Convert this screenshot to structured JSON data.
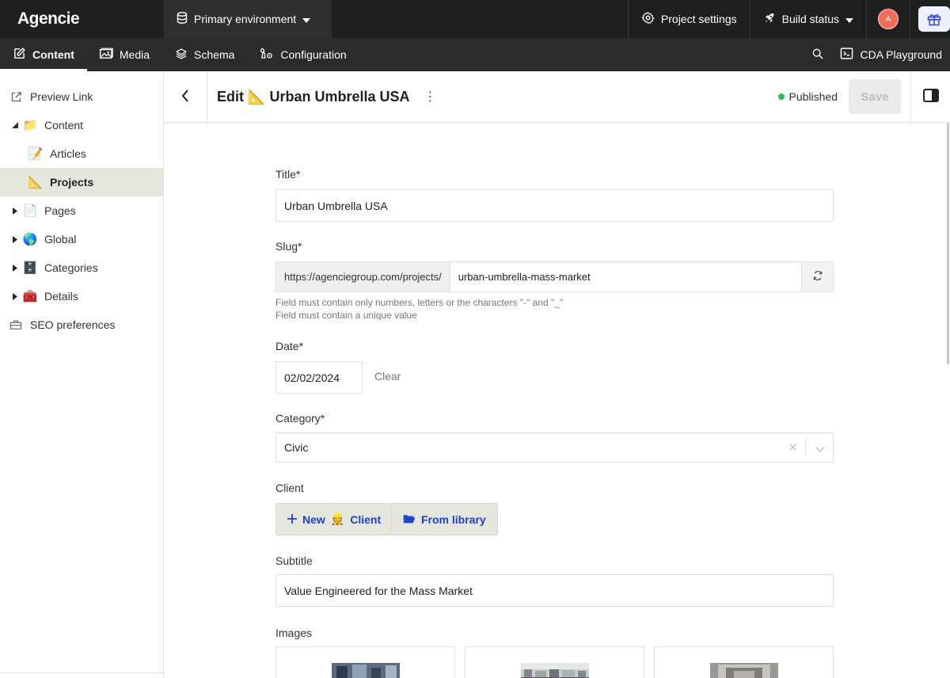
{
  "topbar": {
    "brand": "Agencie",
    "environment": "Primary environment",
    "project_settings": "Project settings",
    "build_status": "Build status",
    "avatar_initial": "A"
  },
  "navbar": {
    "items": [
      {
        "label": "Content",
        "icon": "edit-icon",
        "active": true
      },
      {
        "label": "Media",
        "icon": "image-icon"
      },
      {
        "label": "Schema",
        "icon": "layers-icon"
      },
      {
        "label": "Configuration",
        "icon": "wrench-icon"
      }
    ],
    "cda_playground": "CDA Playground"
  },
  "sidebar": {
    "items": [
      {
        "label": "Preview Link",
        "icon": "external-link-icon"
      },
      {
        "label": "Content",
        "emoji": "📁",
        "expanded": true
      },
      {
        "label": "Articles",
        "emoji": "📝"
      },
      {
        "label": "Projects",
        "emoji": "📐",
        "active": true
      },
      {
        "label": "Pages",
        "emoji": "📄"
      },
      {
        "label": "Global",
        "emoji": "🌎"
      },
      {
        "label": "Categories",
        "emoji": "🗄️"
      },
      {
        "label": "Details",
        "emoji": "🧰"
      },
      {
        "label": "SEO preferences",
        "icon": "toolbox-icon"
      }
    ]
  },
  "header": {
    "title_prefix": "Edit",
    "title_emoji": "📐",
    "title": "Urban Umbrella USA",
    "status": "Published",
    "save_label": "Save"
  },
  "form": {
    "title_label": "Title*",
    "title_value": "Urban Umbrella USA",
    "slug_label": "Slug*",
    "slug_prefix": "https://agenciegroup.com/projects/",
    "slug_value": "urban-umbrella-mass-market",
    "slug_hint_1": "Field must contain only numbers, letters or the characters \"-\" and \"_\"",
    "slug_hint_2": "Field must contain a unique value",
    "date_label": "Date*",
    "date_value": "02/02/2024",
    "date_clear": "Clear",
    "category_label": "Category*",
    "category_value": "Civic",
    "client_label": "Client",
    "client_new": "New",
    "client_new_emoji": "👷",
    "client_new_suffix": "Client",
    "client_library": "From library",
    "subtitle_label": "Subtitle",
    "subtitle_value": "Value Engineered for the Mass Market",
    "images_label": "Images"
  },
  "colors": {
    "topbar_bg": "#1f1f1f",
    "accent_blue": "#1f3fcf",
    "published_green": "#27c24c",
    "active_sidebar_bg": "#e5e7dd"
  }
}
